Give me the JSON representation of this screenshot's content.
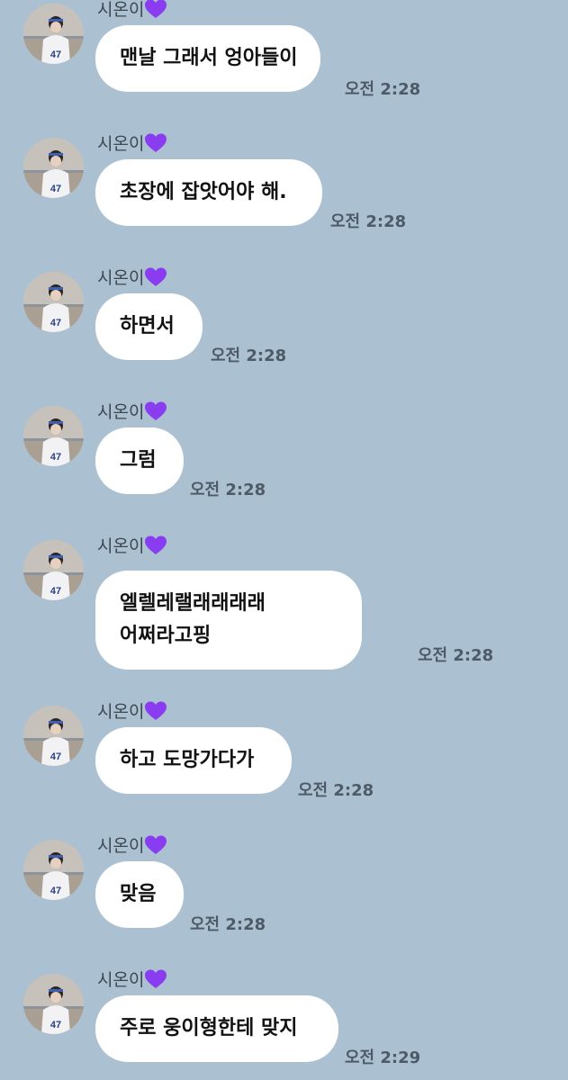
{
  "sender_name": "시온이",
  "messages": [
    {
      "sender": "시온이",
      "text": "맨날 그래서 엉아들이",
      "time": "오전 2:28"
    },
    {
      "sender": "시온이",
      "text": "초장에 잡앗어야 해.",
      "time": "오전 2:28"
    },
    {
      "sender": "시온이",
      "text": "하면서",
      "time": "오전 2:28"
    },
    {
      "sender": "시온이",
      "text": "그럼",
      "time": "오전 2:28"
    },
    {
      "sender": "시온이",
      "lines": [
        "엘렐레랠래래래래",
        "어쩌라고핑"
      ],
      "time": "오전 2:28"
    },
    {
      "sender": "시온이",
      "text": "하고 도망가다가",
      "time": "오전 2:28"
    },
    {
      "sender": "시온이",
      "text": "맞음",
      "time": "오전 2:28"
    },
    {
      "sender": "시온이",
      "text": "주로 웅이형한테 맞지",
      "time": "오전 2:29"
    }
  ],
  "colors": {
    "background": "#abc1d1",
    "bubble": "#ffffff",
    "heart": "#8a3cf0"
  }
}
